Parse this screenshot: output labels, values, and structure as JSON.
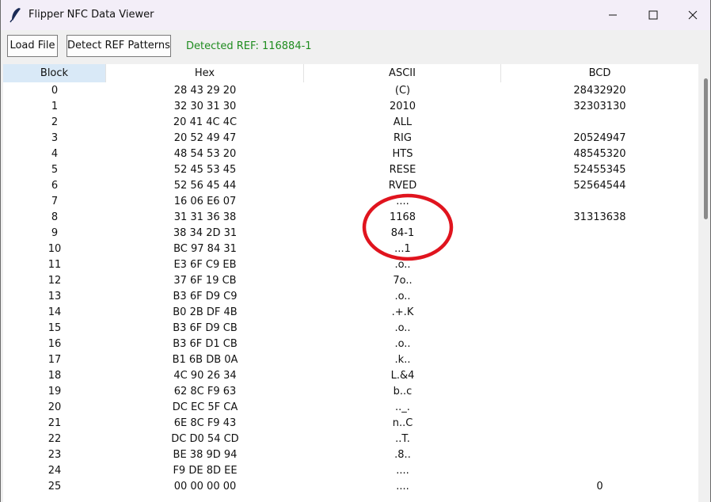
{
  "window": {
    "title": "Flipper NFC Data Viewer"
  },
  "toolbar": {
    "load_label": "Load File",
    "detect_label": "Detect REF Patterns",
    "detected_text": "Detected REF: 116884-1"
  },
  "colors": {
    "accent_green": "#1f8c1f",
    "annotation_red": "#e0141e",
    "header_active": "#d9e9f7"
  },
  "table": {
    "columns": [
      "Block",
      "Hex",
      "ASCII",
      "BCD"
    ],
    "rows": [
      [
        "0",
        "28 43 29 20",
        "(C)",
        "28432920"
      ],
      [
        "1",
        "32 30 31 30",
        "2010",
        "32303130"
      ],
      [
        "2",
        "20 41 4C 4C",
        "ALL",
        ""
      ],
      [
        "3",
        "20 52 49 47",
        "RIG",
        "20524947"
      ],
      [
        "4",
        "48 54 53 20",
        "HTS",
        "48545320"
      ],
      [
        "5",
        "52 45 53 45",
        "RESE",
        "52455345"
      ],
      [
        "6",
        "52 56 45 44",
        "RVED",
        "52564544"
      ],
      [
        "7",
        "16 06 E6 07",
        "....",
        ""
      ],
      [
        "8",
        "31 31 36 38",
        "1168",
        "31313638"
      ],
      [
        "9",
        "38 34 2D 31",
        "84-1",
        ""
      ],
      [
        "10",
        "BC 97 84 31",
        "...1",
        ""
      ],
      [
        "11",
        "E3 6F C9 EB",
        ".o..",
        ""
      ],
      [
        "12",
        "37 6F 19 CB",
        "7o..",
        ""
      ],
      [
        "13",
        "B3 6F D9 C9",
        ".o..",
        ""
      ],
      [
        "14",
        "B0 2B DF 4B",
        ".+.K",
        ""
      ],
      [
        "15",
        "B3 6F D9 CB",
        ".o..",
        ""
      ],
      [
        "16",
        "B3 6F D1 CB",
        ".o..",
        ""
      ],
      [
        "17",
        "B1 6B DB 0A",
        ".k..",
        ""
      ],
      [
        "18",
        "4C 90 26 34",
        "L.&4",
        ""
      ],
      [
        "19",
        "62 8C F9 63",
        "b..c",
        ""
      ],
      [
        "20",
        "DC EC 5F CA",
        ".._.",
        ""
      ],
      [
        "21",
        "6E 8C F9 43",
        "n..C",
        ""
      ],
      [
        "22",
        "DC D0 54 CD",
        "..T.",
        ""
      ],
      [
        "23",
        "BE 38 9D 94",
        ".8..",
        ""
      ],
      [
        "24",
        "F9 DE 8D EE",
        "....",
        ""
      ],
      [
        "25",
        "00 00 00 00",
        "....",
        "0"
      ]
    ]
  }
}
